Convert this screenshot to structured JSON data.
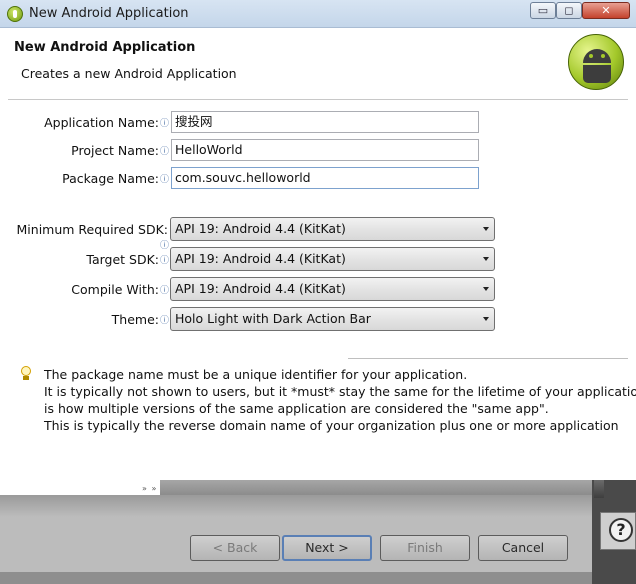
{
  "window": {
    "title": "New Android Application",
    "controls": {
      "minimize": "▭",
      "maximize": "◻",
      "close": "✕"
    }
  },
  "banner": {
    "title": "New Android Application",
    "subtitle": "Creates a new Android Application",
    "logo_icon": "android-icon"
  },
  "form": {
    "application_name": {
      "label": "Application Name:",
      "value": "搜投网"
    },
    "project_name": {
      "label": "Project Name:",
      "value": "HelloWorld"
    },
    "package_name": {
      "label": "Package Name:",
      "value": "com.souvc.helloworld"
    },
    "min_sdk": {
      "label": "Minimum Required SDK:",
      "value": "API 19: Android 4.4 (KitKat)"
    },
    "target_sdk": {
      "label": "Target SDK:",
      "value": "API 19: Android 4.4 (KitKat)"
    },
    "compile_with": {
      "label": "Compile With:",
      "value": "API 19: Android 4.4 (KitKat)"
    },
    "theme": {
      "label": "Theme:",
      "value": "Holo Light with Dark Action Bar"
    },
    "info_marker": "ⓘ"
  },
  "hint": {
    "icon": "lightbulb-icon",
    "lines": [
      "The package name must be a unique identifier for your application.",
      "It is typically not shown to users, but it *must* stay the same for the lifetime of your application; it",
      "is how multiple versions of the same application are considered the \"same app\".",
      "This is typically the reverse domain name of your organization plus one or more application"
    ]
  },
  "dock_handle": "» »",
  "help": {
    "label": "?"
  },
  "buttons": {
    "back": "< Back",
    "next": "Next >",
    "finish": "Finish",
    "cancel": "Cancel"
  },
  "colors": {
    "android_green": "#a3c82a",
    "focus_border": "#5a7fb5"
  }
}
